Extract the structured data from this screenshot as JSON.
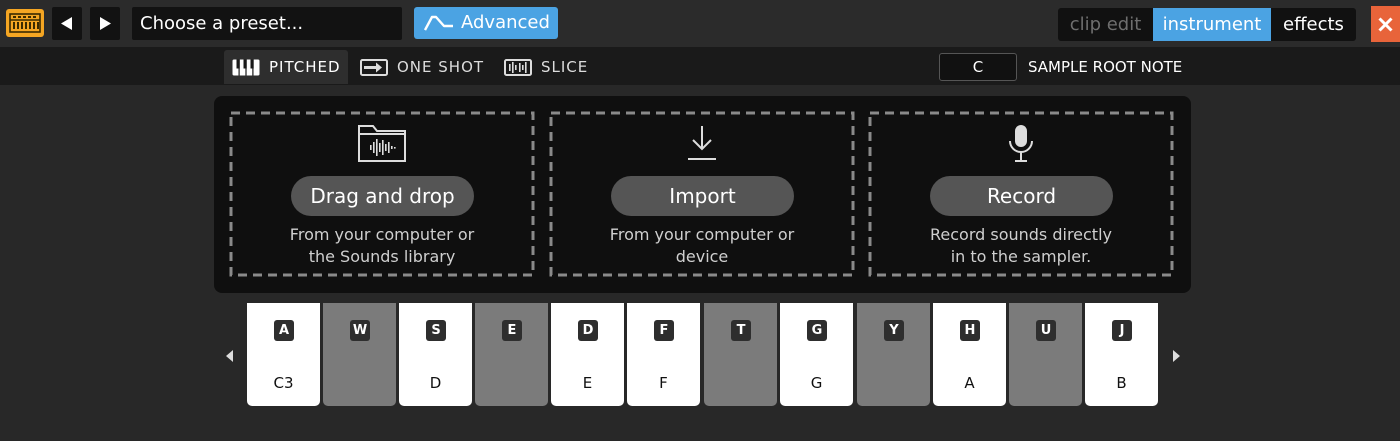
{
  "toolbar": {
    "app_icon": "keyboard-grid-icon",
    "prev_icon": "triangle-left-icon",
    "next_icon": "triangle-right-icon",
    "preset_value": "Choose a preset...",
    "advanced_label": "Advanced",
    "advanced_icon": "envelope-wave-icon",
    "tabs": [
      {
        "label": "clip edit",
        "state": "disabled"
      },
      {
        "label": "instrument",
        "state": "selected"
      },
      {
        "label": "effects",
        "state": "normal"
      }
    ],
    "close_icon": "close-x-icon"
  },
  "modes": [
    {
      "label": "PITCHED",
      "icon": "piano-keys-icon",
      "selected": true
    },
    {
      "label": "ONE SHOT",
      "icon": "one-shot-icon",
      "selected": false
    },
    {
      "label": "SLICE",
      "icon": "slice-icon",
      "selected": false
    }
  ],
  "root_note": {
    "value": "C",
    "label": "SAMPLE ROOT NOTE"
  },
  "sources": [
    {
      "icon": "folder-waveform-icon",
      "button": "Drag and drop",
      "line1": "From your computer or",
      "line2": "the Sounds library"
    },
    {
      "icon": "download-icon",
      "button": "Import",
      "line1": "From your computer or",
      "line2": "device"
    },
    {
      "icon": "microphone-icon",
      "button": "Record",
      "line1": "Record sounds directly",
      "line2": "in to the sampler."
    }
  ],
  "keyboard": {
    "keys": [
      {
        "shortcut": "A",
        "note": "C3",
        "color": "white"
      },
      {
        "shortcut": "W",
        "note": "",
        "color": "black"
      },
      {
        "shortcut": "S",
        "note": "D",
        "color": "white"
      },
      {
        "shortcut": "E",
        "note": "",
        "color": "black"
      },
      {
        "shortcut": "D",
        "note": "E",
        "color": "white"
      },
      {
        "shortcut": "F",
        "note": "F",
        "color": "white"
      },
      {
        "shortcut": "T",
        "note": "",
        "color": "black"
      },
      {
        "shortcut": "G",
        "note": "G",
        "color": "white"
      },
      {
        "shortcut": "Y",
        "note": "",
        "color": "black"
      },
      {
        "shortcut": "H",
        "note": "A",
        "color": "white"
      },
      {
        "shortcut": "U",
        "note": "",
        "color": "black"
      },
      {
        "shortcut": "J",
        "note": "B",
        "color": "white"
      }
    ],
    "octave_down_icon": "caret-left-icon",
    "octave_up_icon": "caret-right-icon"
  },
  "colors": {
    "accent": "#4ba3e3",
    "close": "#e8643a",
    "app_icon": "#f5a623",
    "background": "#282828",
    "panel": "#0f0f0f"
  }
}
